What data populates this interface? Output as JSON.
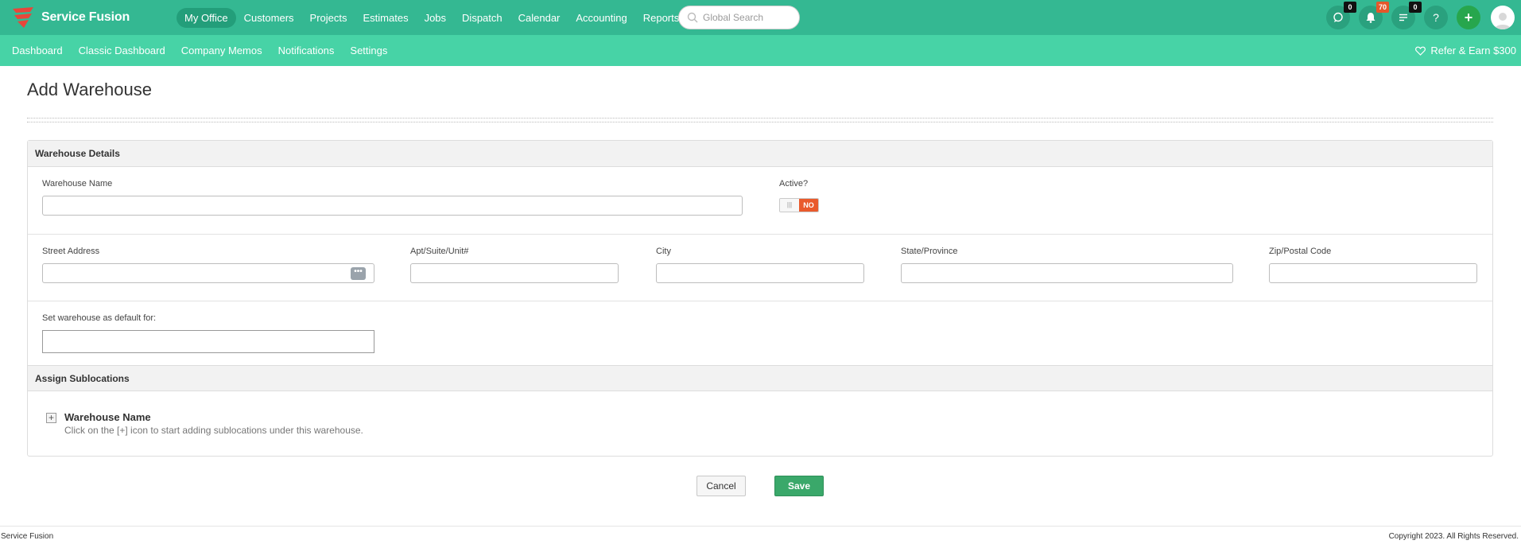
{
  "app": {
    "name": "Service Fusion"
  },
  "main_nav": [
    {
      "label": "My Office",
      "active": true
    },
    {
      "label": "Customers"
    },
    {
      "label": "Projects"
    },
    {
      "label": "Estimates"
    },
    {
      "label": "Jobs"
    },
    {
      "label": "Dispatch"
    },
    {
      "label": "Calendar"
    },
    {
      "label": "Accounting"
    },
    {
      "label": "Reports"
    }
  ],
  "search": {
    "placeholder": "Global Search"
  },
  "top_icons": {
    "chat_badge": "0",
    "notifications_badge": "70",
    "tasks_badge": "0",
    "help_label": "?",
    "add_label": "+"
  },
  "sub_nav": [
    {
      "label": "Dashboard"
    },
    {
      "label": "Classic Dashboard"
    },
    {
      "label": "Company Memos"
    },
    {
      "label": "Notifications"
    },
    {
      "label": "Settings"
    }
  ],
  "refer": {
    "label": "Refer & Earn $300"
  },
  "page": {
    "title": "Add Warehouse"
  },
  "warehouse_details": {
    "heading": "Warehouse Details",
    "name_label": "Warehouse Name",
    "name_value": "",
    "active_label": "Active?",
    "active_value": "NO",
    "street_label": "Street Address",
    "street_value": "",
    "apt_label": "Apt/Suite/Unit#",
    "apt_value": "",
    "city_label": "City",
    "city_value": "",
    "state_label": "State/Province",
    "state_value": "",
    "zip_label": "Zip/Postal Code",
    "zip_value": "",
    "default_label": "Set warehouse as default for:",
    "default_value": ""
  },
  "sublocations": {
    "heading": "Assign Sublocations",
    "tree_title": "Warehouse Name",
    "hint": "Click on the [+] icon to start adding sublocations under this warehouse."
  },
  "actions": {
    "cancel": "Cancel",
    "save": "Save"
  },
  "footer": {
    "left": "Service Fusion",
    "right": "Copyright 2023. All Rights Reserved."
  },
  "colors": {
    "topbar": "#34b892",
    "subbar": "#47d3a6",
    "save": "#3aa86a",
    "toggle_no": "#e95a2c"
  }
}
